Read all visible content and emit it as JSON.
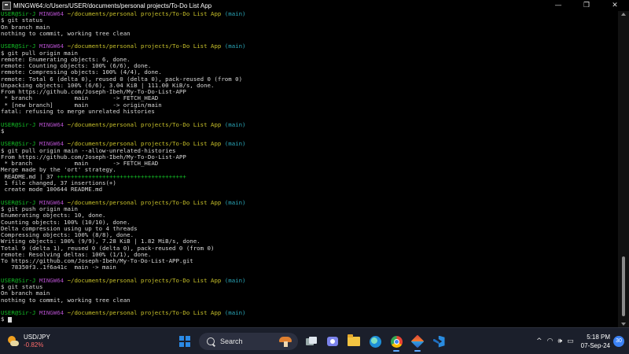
{
  "window": {
    "title": "MINGW64:/c/Users/USER/documents/personal projects/To-Do List App",
    "minimize_glyph": "—",
    "maximize_glyph": "❐",
    "close_glyph": "✕"
  },
  "prompt": {
    "user": "USER@Sir-J",
    "shell": "MINGW64",
    "path": "~/documents/personal projects/To-Do List App",
    "branch": "(main)",
    "symbol": "$"
  },
  "output": {
    "cmd1": "$ git status",
    "l1": "On branch main",
    "l2": "nothing to commit, working tree clean",
    "cmd2": "$ git pull origin main",
    "l3": "remote: Enumerating objects: 6, done.",
    "l4": "remote: Counting objects: 100% (6/6), done.",
    "l5": "remote: Compressing objects: 100% (4/4), done.",
    "l6": "remote: Total 6 (delta 0), reused 0 (delta 0), pack-reused 0 (from 0)",
    "l7": "Unpacking objects: 100% (6/6), 3.04 KiB | 111.00 KiB/s, done.",
    "l8": "From https://github.com/Joseph-Ibeh/My-To-Do-List-APP",
    "l9": " * branch            main       -> FETCH_HEAD",
    "l10": " * [new branch]      main       -> origin/main",
    "l11": "fatal: refusing to merge unrelated histories",
    "cmd3": "$",
    "cmd4": "$ git pull origin main --allow-unrelated-histories",
    "l12": "From https://github.com/Joseph-Ibeh/My-To-Do-List-APP",
    "l13": " * branch            main       -> FETCH_HEAD",
    "l14": "Merge made by the 'ort' strategy.",
    "l15_file": " README.md | 37 ",
    "l15_plus": "+++++++++++++++++++++++++++++++++++++",
    "l16": " 1 file changed, 37 insertions(+)",
    "l17": " create mode 100644 README.md",
    "cmd5": "$ git push origin main",
    "l18": "Enumerating objects: 10, done.",
    "l19": "Counting objects: 100% (10/10), done.",
    "l20": "Delta compression using up to 4 threads",
    "l21": "Compressing objects: 100% (8/8), done.",
    "l22": "Writing objects: 100% (9/9), 7.28 KiB | 1.82 MiB/s, done.",
    "l23": "Total 9 (delta 1), reused 0 (delta 0), pack-reused 0 (from 0)",
    "l24": "remote: Resolving deltas: 100% (1/1), done.",
    "l25": "To https://github.com/Joseph-Ibeh/My-To-Do-List-APP.git",
    "l26": "   78350f3..1f6a41c  main -> main",
    "cmd6": "$ git status",
    "l27": "On branch main",
    "l28": "nothing to commit, working tree clean",
    "cmd7": "$"
  },
  "taskbar": {
    "weather_ticker": "USD/JPY",
    "weather_change": "-0.82%",
    "search_label": "Search",
    "tray_chevron": "^",
    "tray_wifi": "◠",
    "tray_volume": "🕪",
    "tray_battery": "▭",
    "time": "5:18 PM",
    "date": "07-Sep-24",
    "notification_count": "30"
  },
  "colors": {
    "prompt_user": "#13bd26",
    "prompt_shell": "#b14ec8",
    "prompt_path": "#c7c02a",
    "prompt_branch": "#2aa6b8",
    "plus_bar": "#13bd26",
    "taskbar_bg": "#1b1f2b"
  },
  "icons": [
    "start-icon",
    "search-icon",
    "task-view-icon",
    "chat-icon",
    "file-explorer-icon",
    "edge-icon",
    "chrome-icon",
    "git-bash-icon",
    "vscode-icon"
  ]
}
